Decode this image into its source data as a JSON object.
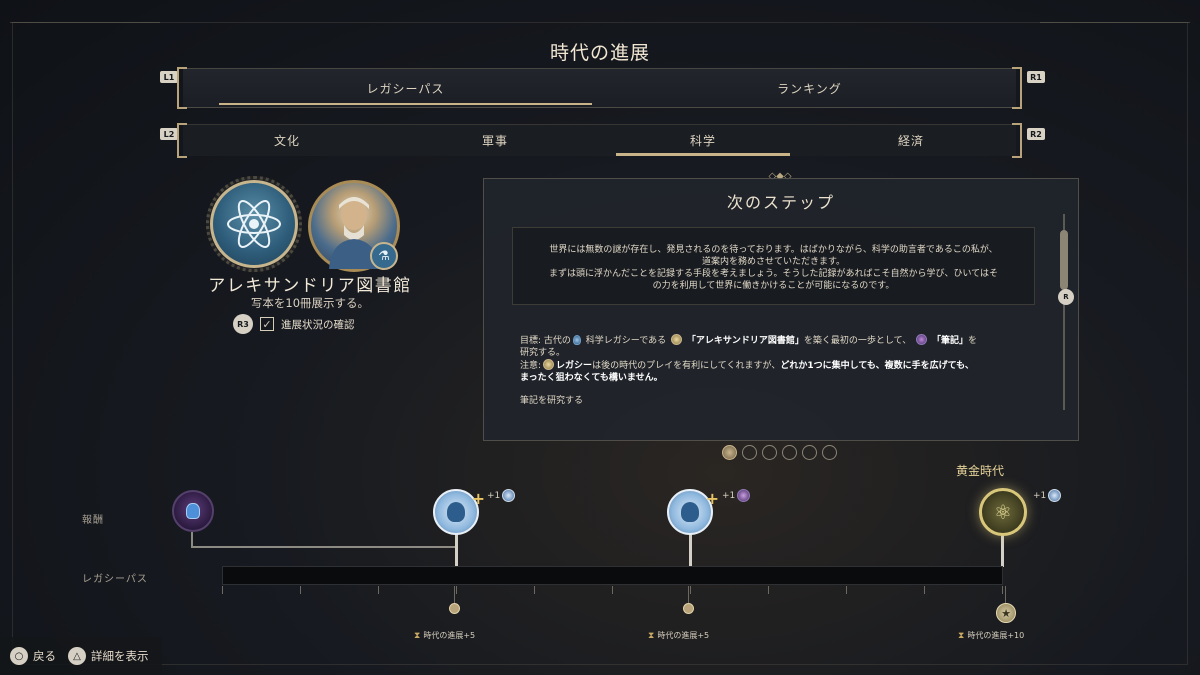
{
  "title": "時代の進展",
  "top_tabs": [
    {
      "label": "レガシーパス",
      "active": true
    },
    {
      "label": "ランキング",
      "active": false
    }
  ],
  "top_tab_hints": {
    "left": "L1",
    "right": "R1"
  },
  "sub_tabs": [
    {
      "label": "文化",
      "active": false
    },
    {
      "label": "軍事",
      "active": false
    },
    {
      "label": "科学",
      "active": true
    },
    {
      "label": "経済",
      "active": false
    }
  ],
  "sub_tab_hints": {
    "left": "L2",
    "right": "R2"
  },
  "legacy": {
    "name": "アレキサンドリア図書館",
    "description": "写本を10冊展示する。",
    "progress_button": "R3",
    "progress_label": "進展状況の確認",
    "checked": true
  },
  "next_step": {
    "title": "次のステップ",
    "quote_line1": "世界には無数の謎が存在し、発見されるのを待っております。はばかりながら、科学の助言者であるこの私が、",
    "quote_line2": "道案内を務めさせていただきます。",
    "quote_line3": "まずは頭に浮かんだことを記録する手段を考えましょう。そうした記録があればこそ自然から学び、ひいてはそ",
    "quote_line4": "の力を利用して世界に働きかけることが可能になるのです。",
    "goal_prefix": "目標: 古代の",
    "goal_mid1": "科学レガシーである",
    "goal_legacy": "「アレキサンドリア図書館」",
    "goal_mid2": "を築く最初の一歩として、",
    "goal_tech": "「筆記」",
    "goal_suffix": "を",
    "goal_line2": "研究する。",
    "note_prefix": "注意:",
    "note_bold1": "レガシー",
    "note_mid": "は後の時代のプレイを有利にしてくれますが、",
    "note_bold2": "どれか1つに集中しても、複数に手を広げても、",
    "note_bold3": "まったく狙わなくても構いません。",
    "action": "筆記を研究する",
    "scroll_hint": "R"
  },
  "pager": {
    "pages": 6,
    "current": 1
  },
  "legacy_path": {
    "reward_label": "報酬",
    "path_label": "レガシーパス",
    "golden_age": "黄金時代",
    "rewards": [
      {
        "icon": "science-potion-icon",
        "bonus": ""
      },
      {
        "icon": "scientist-plus-icon",
        "bonus": "+1"
      },
      {
        "icon": "scientist-plus-icon",
        "bonus": "+1"
      },
      {
        "icon": "golden-atom-icon",
        "bonus": "+1"
      }
    ],
    "milestones": [
      {
        "label": "時代の進展+5"
      },
      {
        "label": "時代の進展+5"
      },
      {
        "label": "時代の進展+10"
      }
    ]
  },
  "footer": {
    "back_button": "○",
    "back_label": "戻る",
    "details_button": "△",
    "details_label": "詳細を表示"
  },
  "colors": {
    "accent_gold": "#c9b48a",
    "panel_bg": "#21252b",
    "science_blue": "#2f5f7c"
  }
}
